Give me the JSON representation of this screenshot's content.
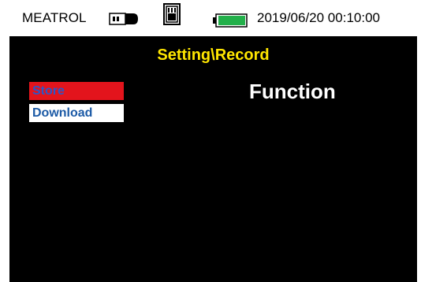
{
  "status_bar": {
    "brand": "MEATROL",
    "datetime": "2019/06/20 00:10:00",
    "icons": [
      "usb-drive-icon",
      "sd-card-icon",
      "battery-full-icon"
    ],
    "battery_color": "#22b04a"
  },
  "screen": {
    "title": "Setting\\Record",
    "title_color": "#ffe600",
    "background": "#000000",
    "menu": [
      {
        "label": "Store",
        "selected": true,
        "highlight_color": "#e3141c"
      },
      {
        "label": "Download",
        "selected": false
      }
    ],
    "function_label": "Function"
  }
}
